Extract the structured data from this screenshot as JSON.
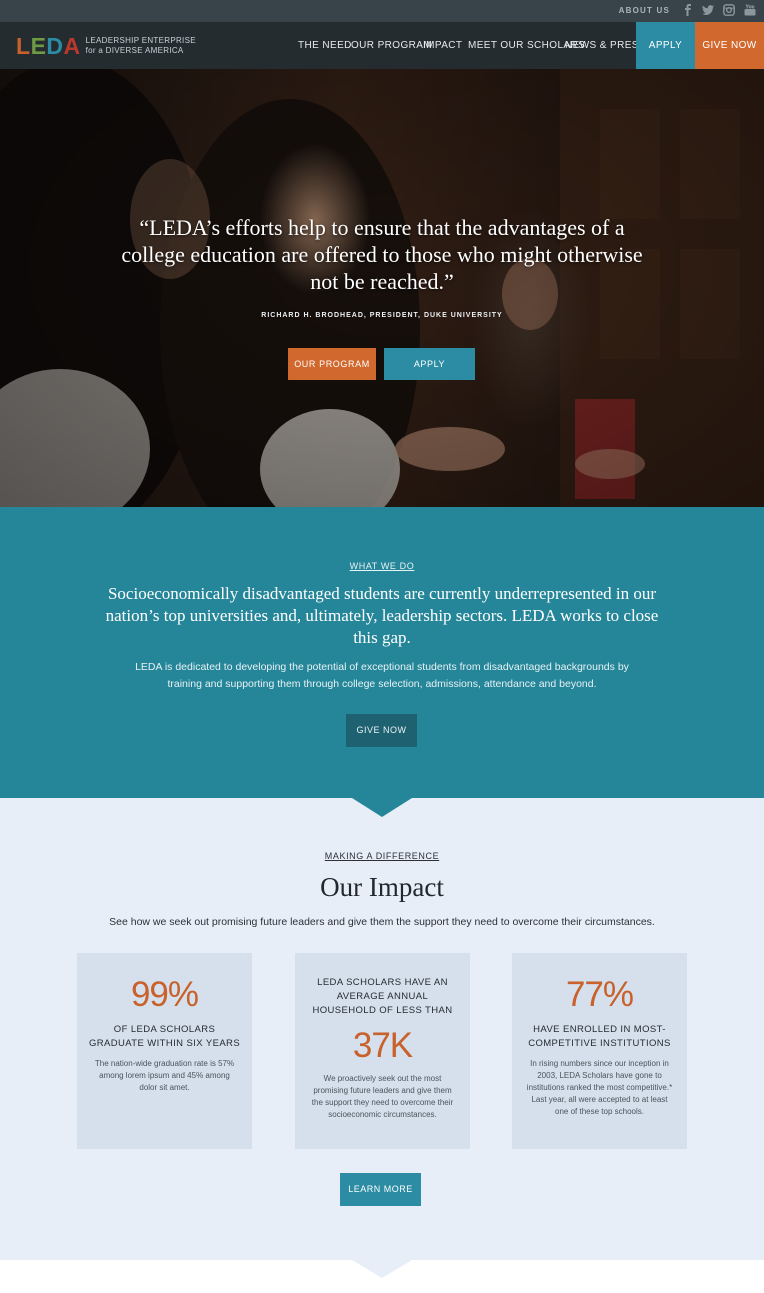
{
  "topbar": {
    "about_label": "ABOUT US",
    "social_icons": [
      "facebook-icon",
      "twitter-icon",
      "instagram-icon",
      "youtube-icon"
    ]
  },
  "nav": {
    "logo_mark": [
      "L",
      "E",
      "D",
      "A"
    ],
    "logo_line1": "LEADERSHIP ENTERPRISE",
    "logo_line2": "for a DIVERSE AMERICA",
    "links": [
      "THE NEED",
      "OUR PROGRAM",
      "IMPACT",
      "MEET OUR SCHOLARS",
      "NEWS & PRESS"
    ],
    "apply_label": "APPLY",
    "give_label": "GIVE NOW"
  },
  "hero": {
    "quote": "“LEDA’s efforts help to ensure that the advantages of a college education are offered to those who might otherwise not be reached.”",
    "attribution": "RICHARD H. BRODHEAD, PRESIDENT, DUKE UNIVERSITY",
    "program_button": "OUR PROGRAM",
    "apply_button": "APPLY"
  },
  "what_we_do": {
    "eyebrow": "WHAT WE DO",
    "headline": "Socioeconomically disadvantaged students are currently underrepresented in our nation’s top universities and, ultimately, leadership sectors. LEDA works to close this gap.",
    "body": "LEDA is dedicated to developing the potential of exceptional students from disadvantaged backgrounds by training and supporting them through college selection, admissions, attendance and beyond.",
    "give_button": "GIVE NOW"
  },
  "impact": {
    "eyebrow": "MAKING A DIFFERENCE",
    "title": "Our Impact",
    "subtitle": "See how we seek out promising future leaders and give them the support they need to overcome their circumstances.",
    "stats": [
      {
        "number": "99%",
        "label": "OF LEDA SCHOLARS GRADUATE WITHIN SIX YEARS",
        "description": "The nation-wide graduation rate is 57% among lorem ipsum and 45% among dolor sit amet."
      },
      {
        "pre_label": "LEDA SCHOLARS HAVE AN AVERAGE ANNUAL HOUSEHOLD OF LESS THAN",
        "number": "37K",
        "description": "We proactively seek out the most promising future leaders and give them the support they need to overcome their socioeconomic circumstances."
      },
      {
        "number": "77%",
        "label": "HAVE ENROLLED IN MOST-COMPETITIVE INSTITUTIONS",
        "description": "In rising numbers since our inception in 2003, LEDA Scholars have gone to institutions ranked the most competitive.* Last year, all were accepted to at least one of these top schools."
      }
    ],
    "learn_button": "LEARN MORE"
  },
  "colors": {
    "teal": "#268699",
    "button_teal": "#2b8ca3",
    "orange": "#d1692e",
    "nav_dark": "#242c30",
    "impact_bg": "#e7eef8",
    "stat_bg": "#d5e0ec"
  }
}
